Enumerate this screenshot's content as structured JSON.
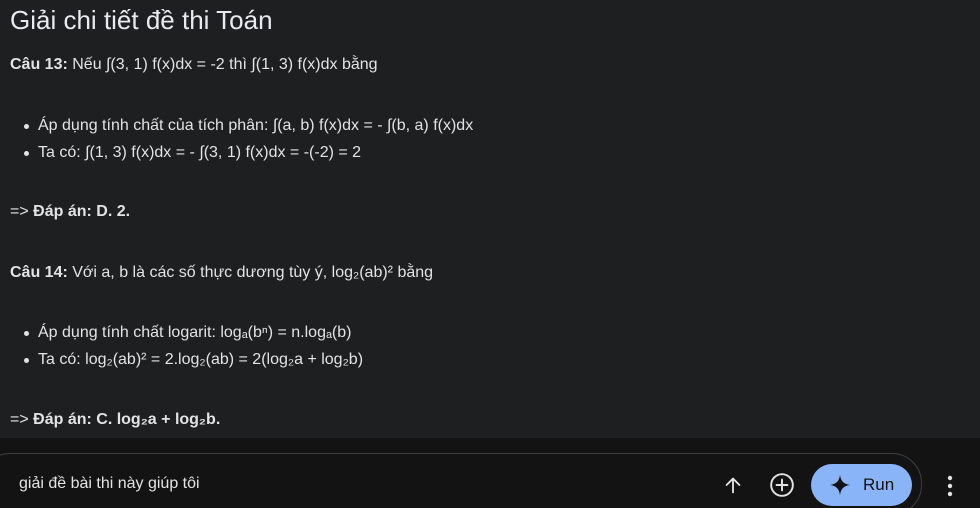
{
  "title": "Giải chi tiết đề thi Toán",
  "q13": {
    "label": "Câu 13:",
    "text": " Nếu ∫(3, 1) f(x)dx = -2 thì ∫(1, 3) f(x)dx bằng",
    "bullets": [
      "Áp dụng tính chất của tích phân: ∫(a, b) f(x)dx = - ∫(b, a) f(x)dx",
      "Ta có: ∫(1, 3) f(x)dx = - ∫(3, 1) f(x)dx = -(-2) = 2"
    ],
    "answer_prefix": "=> ",
    "answer": "Đáp án: D. 2."
  },
  "q14": {
    "label": "Câu 14:",
    "text": " Với a, b là các số thực dương tùy ý, log₂(ab)² bằng",
    "bullets": [
      "Áp dụng tính chất logarit: logₐ(bⁿ) = n.logₐ(b)",
      "Ta có: log₂(ab)² = 2.log₂(ab) = 2(log₂a + log₂b)"
    ],
    "answer_prefix": "=> ",
    "answer": "Đáp án: C. log₂a + log₂b."
  },
  "prompt": {
    "value": "giải đề bài thi này giúp tôi"
  },
  "toolbar": {
    "run_label": "Run",
    "upload_icon": "arrow-up-icon",
    "add_icon": "plus-circle-icon",
    "more_icon": "more-vertical-icon"
  },
  "colors": {
    "background": "#1e1f20",
    "input_background": "#131314",
    "run_button": "#8ab4f8",
    "text": "#e3e3e3"
  }
}
